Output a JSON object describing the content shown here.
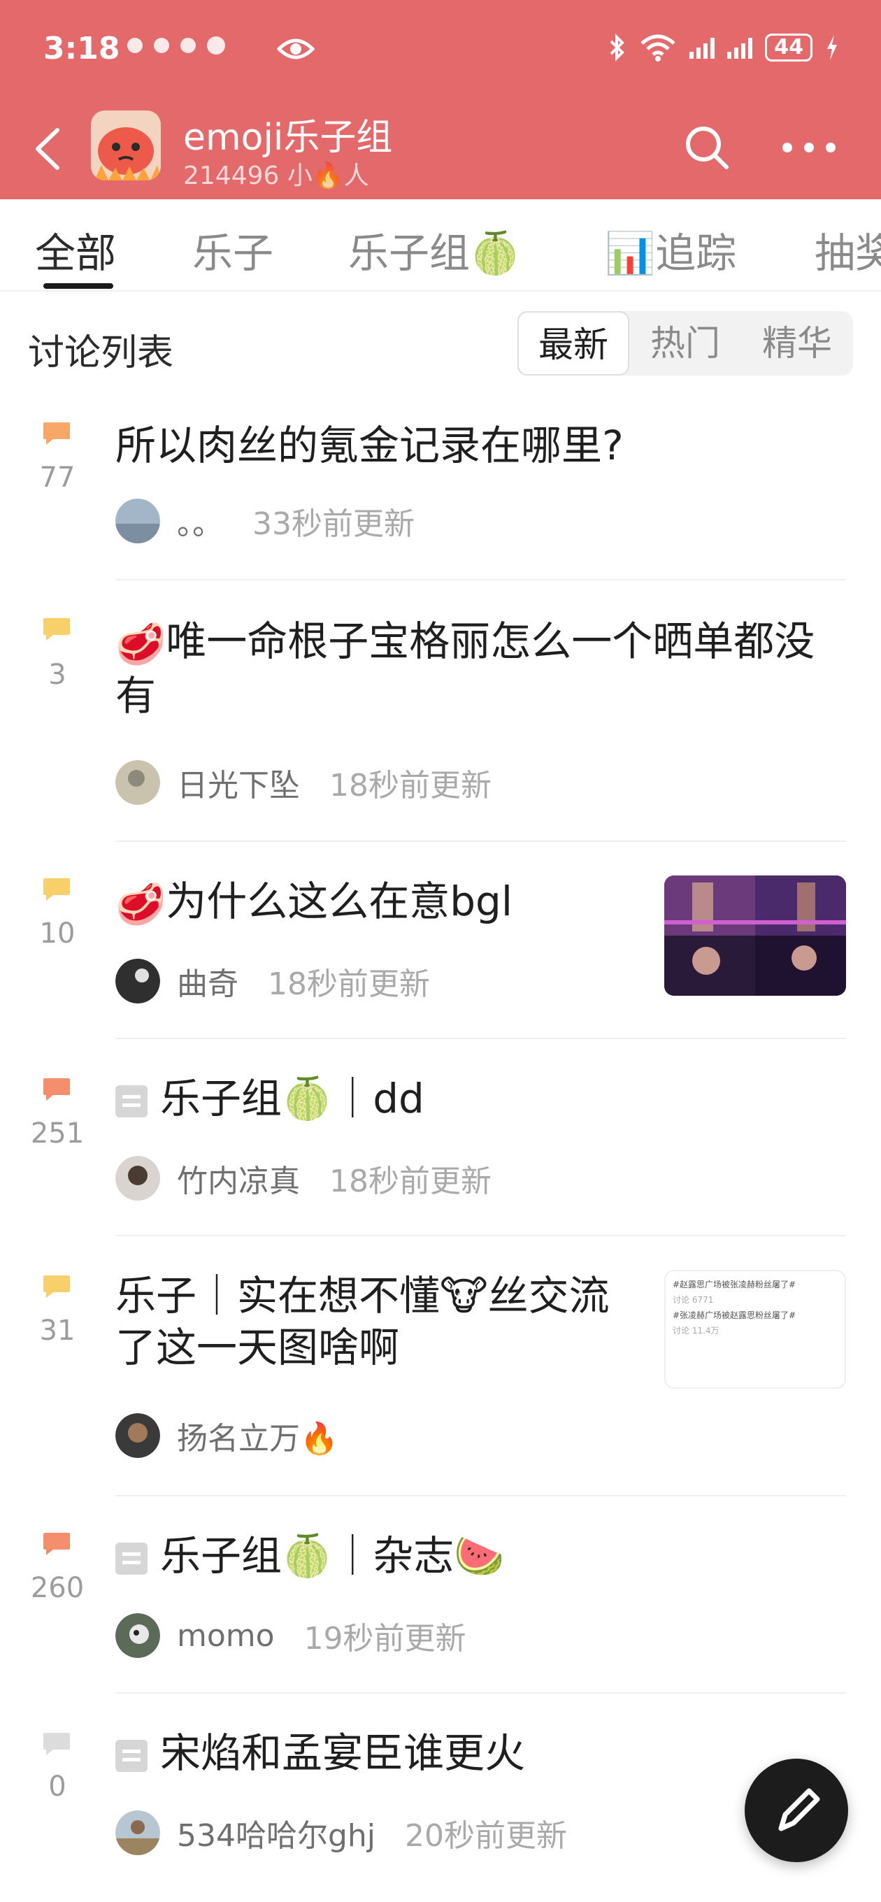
{
  "status_bar": {
    "time": "3:18",
    "battery": "44"
  },
  "header": {
    "title": "emoji乐子组",
    "count": "214496 小🔥人"
  },
  "tabs": [
    "全部",
    "乐子",
    "乐子组🍈",
    "📊追踪",
    "抽奖"
  ],
  "list": {
    "title": "讨论列表",
    "sort_options": [
      "最新",
      "热门",
      "精华"
    ]
  },
  "posts": [
    {
      "count": "77",
      "title": "所以肉丝的氪金记录在哪里?",
      "user": "。。",
      "time": "33秒前更新",
      "bubble": "#f7a868"
    },
    {
      "count": "3",
      "title_prefix": "🥩",
      "title": "唯一命根子宝格丽怎么一个晒单都没有",
      "user": "日光下坠",
      "time": "18秒前更新",
      "bubble": "#f8d06a"
    },
    {
      "count": "10",
      "title_prefix": "🥩",
      "title": "为什么这么在意bgl",
      "user": "曲奇",
      "time": "18秒前更新",
      "bubble": "#f8d06a"
    },
    {
      "count": "251",
      "title_a": "乐子组🍈",
      "title_b": "｜dd",
      "user": "竹内凉真",
      "time": "18秒前更新",
      "bubble": "#f58e6d"
    },
    {
      "count": "31",
      "title": "乐子｜实在想不懂🐮丝交流了这一天图啥啊",
      "user": "扬名立万🔥",
      "time": "",
      "bubble": "#f8d06a"
    },
    {
      "count": "260",
      "title_a": "乐子组🍈",
      "title_b": "｜杂志🍉",
      "user": "momo",
      "time": "19秒前更新",
      "bubble": "#f58e6d"
    },
    {
      "count": "0",
      "title": "宋焰和孟宴臣谁更火",
      "user": "534哈哈尔ghj",
      "time": "20秒前更新",
      "bubble": "#dcdcdc"
    }
  ],
  "thumb_text": [
    "#赵露思广场被张凌赫粉丝屠了#",
    "#张凌赫广场被赵露思粉丝屠了#",
    "讨论 6771",
    "讨论 11.4万"
  ]
}
